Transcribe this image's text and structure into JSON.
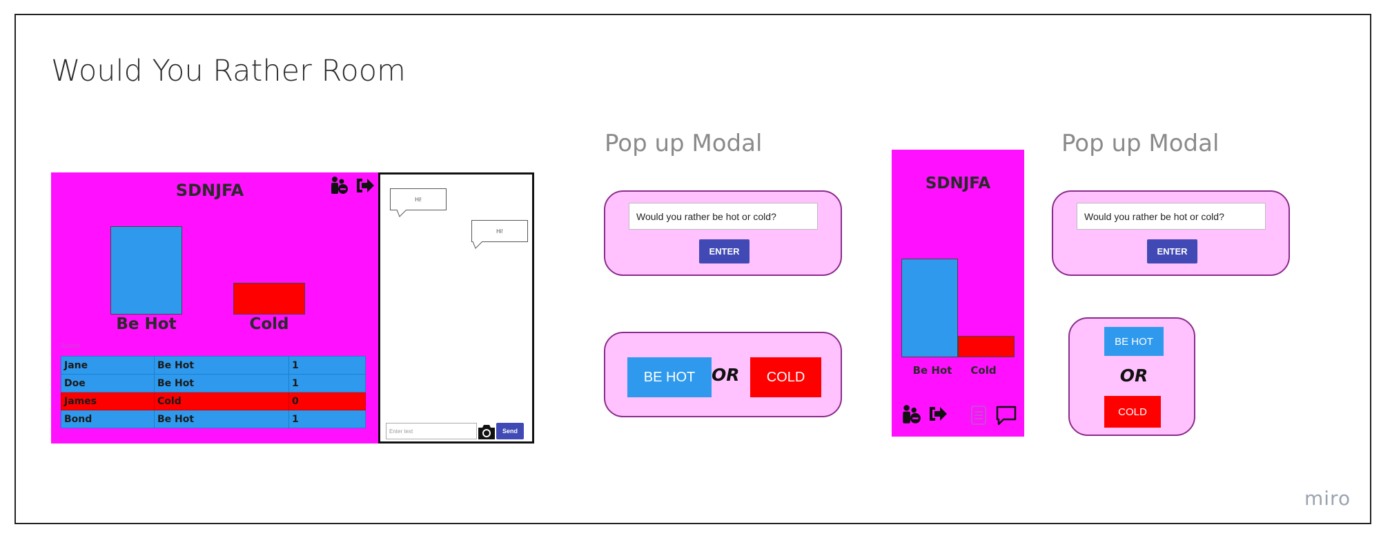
{
  "board": {
    "title": "Would You Rather Room",
    "watermark": "miro"
  },
  "desktop": {
    "room_code": "SDNJFA",
    "icons": [
      "users-icon",
      "logout-icon"
    ],
    "chart_labels": {
      "hot": "Be Hot",
      "cold": "Cold"
    },
    "scores_caption": "Scores",
    "scores": [
      {
        "name": "Jane",
        "choice": "Be Hot",
        "points": "1"
      },
      {
        "name": "Doe",
        "choice": "Be Hot",
        "points": "1"
      },
      {
        "name": "James",
        "choice": "Cold",
        "points": "0"
      },
      {
        "name": "Bond",
        "choice": "Be Hot",
        "points": "1"
      }
    ],
    "chat": {
      "messages": [
        {
          "text": "Hi!"
        },
        {
          "text": "Hi!"
        }
      ],
      "input_placeholder": "Enter text",
      "send_label": "Send"
    }
  },
  "popup_left": {
    "title": "Pop up Modal",
    "question": "Would you rather be hot or cold?",
    "enter_label": "ENTER",
    "option_hot": "BE HOT",
    "or_label": "OR",
    "option_cold": "COLD"
  },
  "mobile": {
    "room_code": "SDNJFA",
    "chart_labels": {
      "hot": "Be Hot",
      "cold": "Cold"
    },
    "icons": [
      "users-icon",
      "logout-icon",
      "list-icon",
      "chat-icon"
    ]
  },
  "popup_right": {
    "title": "Pop up Modal",
    "question": "Would you rather be hot or cold?",
    "enter_label": "ENTER",
    "option_hot": "BE HOT",
    "or_label": "OR",
    "option_cold": "COLD"
  },
  "colors": {
    "magenta": "#ff10ff",
    "blue": "#2f9aed",
    "red": "#ff0000",
    "modal_bg": "#ffc2ff",
    "button": "#4049b4"
  }
}
